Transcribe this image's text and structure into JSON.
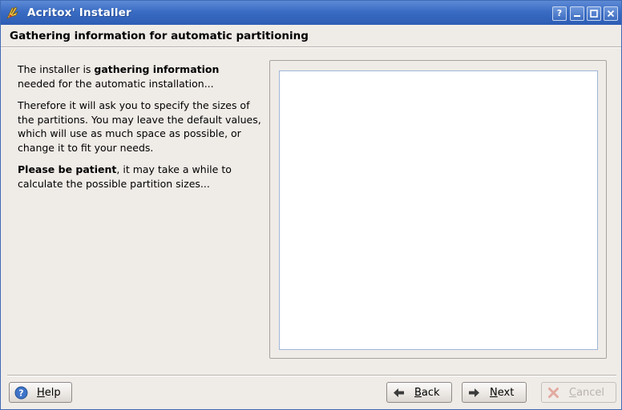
{
  "window": {
    "title": "Acritox' Installer",
    "controls": {
      "help": "?",
      "minimize": "‒",
      "maximize": "□",
      "close": "✕"
    }
  },
  "header": {
    "title": "Gathering information for automatic partitioning"
  },
  "description": {
    "p1_prefix": "The installer is ",
    "p1_bold": "gathering information",
    "p1_suffix": "needed for the automatic installation...",
    "p2": "Therefore it will ask you to specify the sizes of the partitions. You may leave the default values, which will use as much space as possible, or change it to fit your needs.",
    "p3_bold": "Please be patient",
    "p3_suffix": ", it may take a while to calculate the possible partition sizes..."
  },
  "buttons": {
    "help": "Help",
    "back": "Back",
    "next": "Next",
    "cancel": "Cancel"
  },
  "colors": {
    "titlebar": "#3a6cc4",
    "window_bg": "#efebe7",
    "panel_inner": "#ffffff"
  }
}
